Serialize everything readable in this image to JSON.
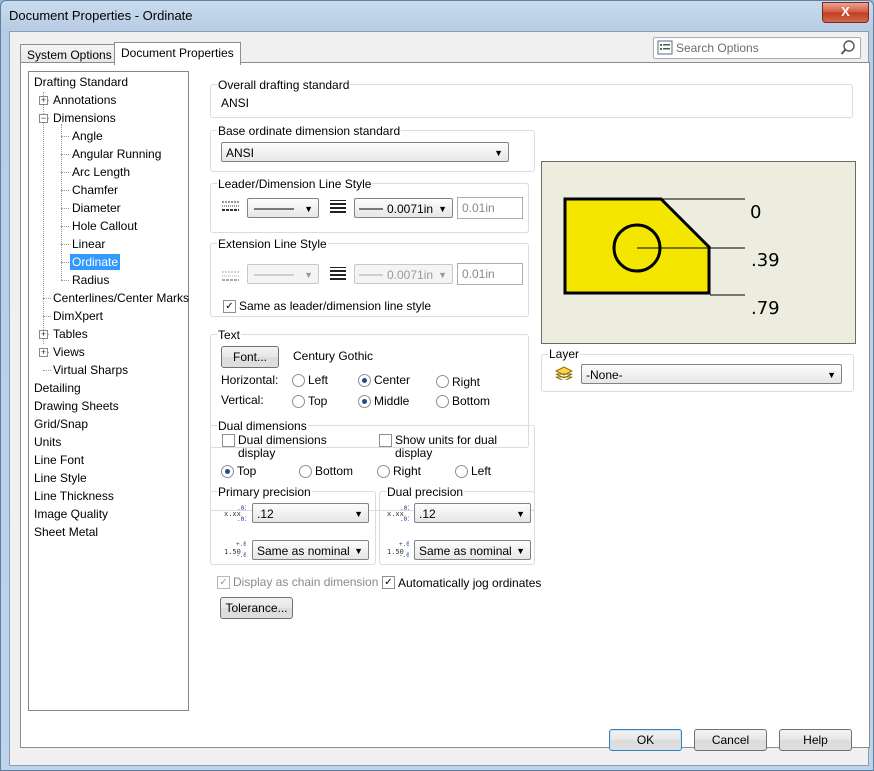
{
  "window": {
    "title": "Document Properties - Ordinate",
    "close_label": "X"
  },
  "tabs": [
    {
      "label": "System Options"
    },
    {
      "label": "Document Properties"
    }
  ],
  "search": {
    "placeholder": "Search Options"
  },
  "tree": {
    "items": [
      {
        "label": "Drafting Standard"
      },
      {
        "label": "Annotations"
      },
      {
        "label": "Dimensions"
      },
      {
        "label": "Angle"
      },
      {
        "label": "Angular Running"
      },
      {
        "label": "Arc Length"
      },
      {
        "label": "Chamfer"
      },
      {
        "label": "Diameter"
      },
      {
        "label": "Hole Callout"
      },
      {
        "label": "Linear"
      },
      {
        "label": "Ordinate"
      },
      {
        "label": "Radius"
      },
      {
        "label": "Centerlines/Center Marks"
      },
      {
        "label": "DimXpert"
      },
      {
        "label": "Tables"
      },
      {
        "label": "Views"
      },
      {
        "label": "Virtual Sharps"
      },
      {
        "label": "Detailing"
      },
      {
        "label": "Drawing Sheets"
      },
      {
        "label": "Grid/Snap"
      },
      {
        "label": "Units"
      },
      {
        "label": "Line Font"
      },
      {
        "label": "Line Style"
      },
      {
        "label": "Line Thickness"
      },
      {
        "label": "Image Quality"
      },
      {
        "label": "Sheet Metal"
      }
    ],
    "selected": "Ordinate"
  },
  "overall": {
    "label": "Overall drafting standard",
    "value": "ANSI"
  },
  "base": {
    "label": "Base ordinate dimension standard",
    "value": "ANSI"
  },
  "leader": {
    "label": "Leader/Dimension Line Style",
    "thickness": "0.0071in",
    "custom": "0.01in"
  },
  "extension": {
    "label": "Extension Line Style",
    "thickness": "0.0071in",
    "custom": "0.01in",
    "same_label": "Same as leader/dimension line style",
    "same_checked": true
  },
  "text": {
    "label": "Text",
    "font_button": "Font...",
    "font_name": "Century Gothic",
    "horizontal_label": "Horizontal:",
    "horizontal_options": [
      "Left",
      "Center",
      "Right"
    ],
    "horizontal_selected": "Center",
    "vertical_label": "Vertical:",
    "vertical_options": [
      "Top",
      "Middle",
      "Bottom"
    ],
    "vertical_selected": "Middle"
  },
  "dual": {
    "label": "Dual dimensions",
    "display_label_1": "Dual dimensions",
    "display_label_2": "display",
    "show_units_1": "Show units for dual",
    "show_units_2": "display",
    "positions": [
      "Top",
      "Bottom",
      "Right",
      "Left"
    ],
    "position_selected": "Top"
  },
  "primary_precision": {
    "label": "Primary precision",
    "value": ".12",
    "tolerance": "Same as nominal"
  },
  "dual_precision": {
    "label": "Dual precision",
    "value": ".12",
    "tolerance": "Same as nominal"
  },
  "chain": {
    "label": "Display as chain dimension",
    "checked": true,
    "disabled": true
  },
  "jog": {
    "label": "Automatically jog ordinates",
    "checked": true
  },
  "tolerance_button": "Tolerance...",
  "preview": {
    "labels": [
      "0",
      ".39",
      ".79"
    ],
    "fill_color": "#f5e600"
  },
  "layer": {
    "label": "Layer",
    "value": "-None-"
  },
  "buttons": {
    "ok": "OK",
    "cancel": "Cancel",
    "help": "Help"
  },
  "glyphs": {
    "check": "✓",
    "arrow": "▼",
    "plus": "+",
    "minus": "−"
  }
}
